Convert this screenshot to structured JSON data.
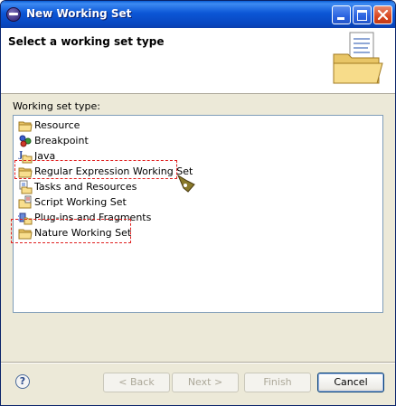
{
  "window": {
    "title": "New Working Set"
  },
  "header": {
    "title": "Select a working set type"
  },
  "content": {
    "label": "Working set type:",
    "items": [
      {
        "label": "Resource",
        "icon": "folder-icon"
      },
      {
        "label": "Breakpoint",
        "icon": "breakpoint-icon"
      },
      {
        "label": "Java",
        "icon": "java-icon"
      },
      {
        "label": "Regular Expression Working Set",
        "icon": "folder-icon"
      },
      {
        "label": "Tasks and Resources",
        "icon": "tasks-icon"
      },
      {
        "label": "Script Working Set",
        "icon": "script-icon"
      },
      {
        "label": "Plug-ins and Fragments",
        "icon": "plugin-icon"
      },
      {
        "label": "Nature Working Set",
        "icon": "folder-icon"
      }
    ]
  },
  "buttons": {
    "back": "< Back",
    "next": "Next >",
    "finish": "Finish",
    "cancel": "Cancel",
    "help": "?"
  },
  "colors": {
    "titlebar": "#0b56d6",
    "dialog_bg": "#ece9d8",
    "callout_border": "#e02020"
  }
}
